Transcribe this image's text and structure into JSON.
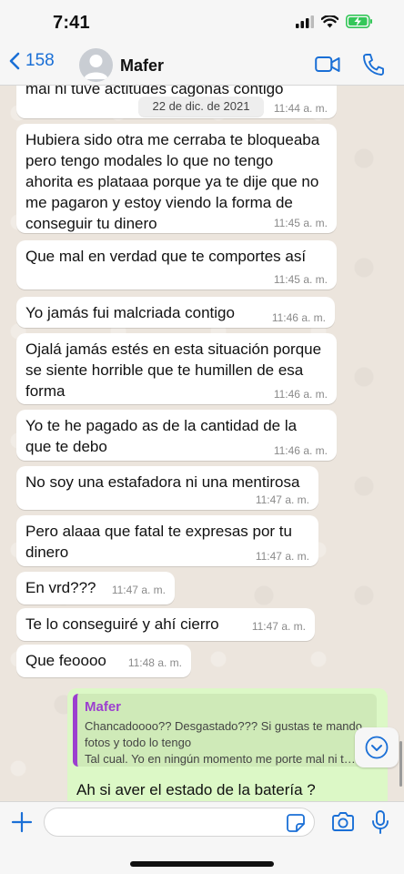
{
  "status_bar": {
    "time": "7:41",
    "icons": [
      "signal-icon",
      "wifi-icon",
      "battery-charging-icon"
    ],
    "battery_color": "#34c759"
  },
  "header": {
    "back_count": "158",
    "contact_name": "Mafer",
    "accent_color": "#1a6fd6"
  },
  "chat": {
    "partial_top_text": "mal ni tuve actitudes cagonas contigo",
    "partial_top_time": "11:44 a. m.",
    "date_pill": "22 de dic. de 2021",
    "messages": [
      {
        "text": "Hubiera sido otra me cerraba te bloqueaba pero tengo modales lo que no tengo ahorita es plataaa porque ya te dije que no me pagaron y estoy viendo la forma de conseguir tu dinero",
        "time": "11:45 a. m."
      },
      {
        "text": "Que mal en verdad que te comportes así",
        "time": "11:45 a. m."
      },
      {
        "text": "Yo jamás fui malcriada contigo",
        "time": "11:46 a. m."
      },
      {
        "text": "Ojalá jamás estés en esta situación porque se siente horrible que te humillen de esa forma",
        "time": "11:46 a. m."
      },
      {
        "text": "Yo te he pagado as de la cantidad de la que te debo",
        "time": "11:46 a. m."
      },
      {
        "text": "No soy una estafadora ni una mentirosa",
        "time": "11:47 a. m."
      },
      {
        "text": "Pero alaaa que fatal te expresas por tu dinero",
        "time": "11:47 a. m."
      },
      {
        "text": "En vrd???",
        "time": "11:47 a. m."
      },
      {
        "text": "Te lo conseguiré y ahí cierro",
        "time": "11:47 a. m."
      },
      {
        "text": "Que feoooo",
        "time": "11:48 a. m."
      }
    ],
    "outgoing": {
      "quote_author": "Mafer",
      "quote_text": "Chancadoooo??  Desgastado??? Si gustas te mando fotos y todo lo tengo\nTal cual. Yo en ningún momento me porte mal ni t…",
      "text": "Ah si aver el estado de la batería ?",
      "bubble_color": "#dcf8c6",
      "quote_color": "#9c3fcf"
    }
  },
  "input_bar": {
    "placeholder": "",
    "icons": [
      "plus-icon",
      "sticker-icon",
      "camera-icon",
      "microphone-icon"
    ]
  }
}
